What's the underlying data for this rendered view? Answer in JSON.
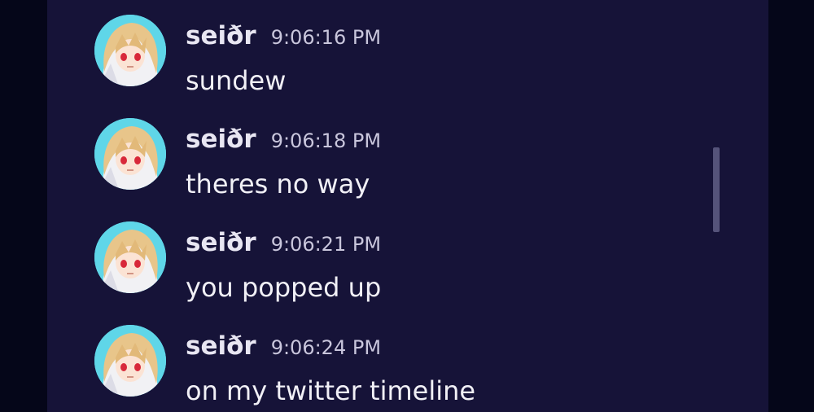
{
  "messages": [
    {
      "author": "seiðr",
      "timestamp": "9:06:16 PM",
      "text": "sundew"
    },
    {
      "author": "seiðr",
      "timestamp": "9:06:18 PM",
      "text": "theres no way"
    },
    {
      "author": "seiðr",
      "timestamp": "9:06:21 PM",
      "text": "you popped up"
    },
    {
      "author": "seiðr",
      "timestamp": "9:06:24 PM",
      "text": "on my twitter timeline"
    }
  ],
  "colors": {
    "background": "#050619",
    "panel": "#161338",
    "author": "#e8e6f2",
    "timestamp": "#c9c6dc",
    "text": "#f1f0f6",
    "scrollbar": "#55537a"
  },
  "icons": {
    "avatar": "anime-avatar-icon"
  }
}
